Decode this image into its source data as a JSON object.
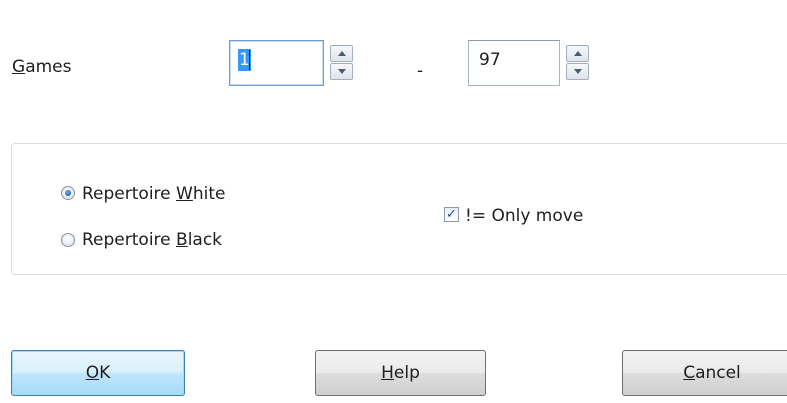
{
  "games": {
    "label_mnemonic": "G",
    "label_rest": "ames",
    "from_value": "1",
    "to_value": "97",
    "separator": "-"
  },
  "options": {
    "repertoire_white": {
      "label_pre": "Repertoire ",
      "label_mnemonic": "W",
      "label_post": "hite",
      "selected": true
    },
    "repertoire_black": {
      "label_pre": "Repertoire ",
      "label_mnemonic": "B",
      "label_post": "lack",
      "selected": false
    },
    "only_move": {
      "label": "!= Only move",
      "checked": true
    }
  },
  "buttons": {
    "ok": {
      "mnemonic": "O",
      "rest": "K"
    },
    "help": {
      "mnemonic": "H",
      "rest": "elp"
    },
    "cancel": {
      "mnemonic": "C",
      "rest": "ancel"
    }
  },
  "colors": {
    "selection": "#3399ff",
    "default_button": "#bee6fd",
    "radio_dot": "#1f5fb5",
    "check_mark": "#1f4e9b"
  }
}
